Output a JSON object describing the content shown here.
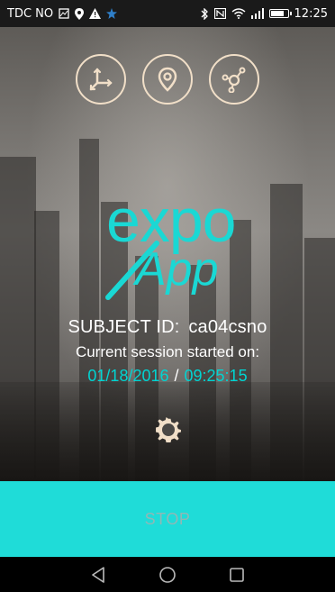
{
  "status_bar": {
    "carrier": "TDC NO",
    "time": "12:25",
    "battery_level": 0.85,
    "icons": [
      "image-icon",
      "location-pin-icon",
      "warning-icon",
      "star-icon",
      "bluetooth-icon",
      "nfc-icon",
      "wifi-icon",
      "signal-icon",
      "battery-icon"
    ]
  },
  "top_actions": [
    {
      "icon": "axes-icon"
    },
    {
      "icon": "location-pin-icon"
    },
    {
      "icon": "network-icon"
    }
  ],
  "logo": {
    "line1": "expo",
    "line2": "App"
  },
  "session": {
    "subject_label": "SUBJECT ID:",
    "subject_id": "ca04csno",
    "started_label": "Current session started on:",
    "date": "01/18/2016",
    "separator": "/",
    "time": "09:25:15"
  },
  "settings": {
    "icon": "gear-icon"
  },
  "stop_button": {
    "label": "STOP"
  },
  "nav": {
    "icons": [
      "back-icon",
      "home-icon",
      "recents-icon"
    ]
  },
  "colors": {
    "accent": "#1fdcd8",
    "accent_text": "#00d4d2",
    "icon_outline": "#f1dfc8"
  }
}
